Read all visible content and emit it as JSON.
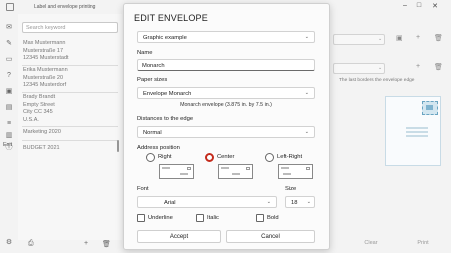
{
  "window": {
    "title": "Label and envelope printing",
    "min_icon": "minimize-icon",
    "max_icon": "maximize-icon",
    "close_icon": "close-icon"
  },
  "rail": {
    "items": [
      "mail-icon",
      "edit-icon",
      "label-icon",
      "help-icon",
      "image-icon",
      "document-icon",
      "list-icon",
      "barcode-icon",
      "info-icon"
    ],
    "exit_label": "Exit",
    "settings_icon": "gear-icon"
  },
  "addresses": {
    "search_placeholder": "Search keyword",
    "items": [
      {
        "lines": [
          "Max Mustermann",
          "Musterstraße 17",
          "12345 Musterstadt"
        ]
      },
      {
        "lines": [
          "Erika Mustermann",
          "Musterstraße 20",
          "12345 Musterdorf"
        ]
      },
      {
        "lines": [
          "Brady Brandt",
          "Empty Street",
          "City CC 345",
          "U.S.A."
        ]
      },
      {
        "lines": [
          "Marketing 2020"
        ]
      },
      {
        "lines": [
          "BUDGET 2021"
        ]
      }
    ]
  },
  "background_right": {
    "warning": "The last borders the envelope edge",
    "clear_label": "Clear",
    "print_label": "Print"
  },
  "dialog": {
    "title": "EDIT ENVELOPE",
    "preset": "Graphic example",
    "name_label": "Name",
    "name_value": "Monarch",
    "paper_sizes_label": "Paper sizes",
    "paper_size_value": "Envelope Monarch",
    "size_note": "Monarch envelope (3.875 in. by 7.5 in.)",
    "distances_label": "Distances to the edge",
    "distance_value": "Normal",
    "address_position_label": "Address position",
    "positions": [
      {
        "label": "Right",
        "selected": false
      },
      {
        "label": "Center",
        "selected": true
      },
      {
        "label": "Left-Right",
        "selected": false
      }
    ],
    "font_label": "Font",
    "font_value": "Arial",
    "size_label": "Size",
    "size_value": "18",
    "underline_label": "Underline",
    "italic_label": "Italic",
    "bold_label": "Bold",
    "accept_label": "Accept",
    "cancel_label": "Cancel",
    "accent_color": "#c42b1c"
  }
}
